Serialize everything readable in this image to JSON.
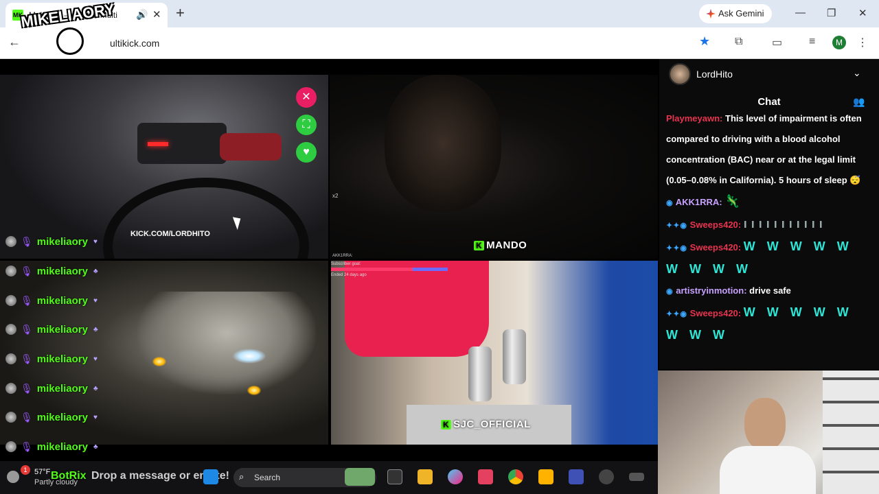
{
  "browser": {
    "tab_title": "MultiKick — Watch Multi",
    "tab_favicon": "MK",
    "new_tab_symbol": "+",
    "gemini_label": "Ask Gemini",
    "url": "ultikick.com",
    "profile_initial": "M"
  },
  "overlay_logo": {
    "text": "MIKELIAORY"
  },
  "streams": [
    {
      "label": "",
      "overlay_url": "KICK.COM/LORDHITO"
    },
    {
      "label": "MANDO",
      "multiplier": "x2"
    },
    {
      "label": ""
    },
    {
      "label": "SJC_OFFICIAL",
      "sub_goal_label": "Subscriber goal:",
      "sub_goal_ended": "Ended 24 days ago",
      "sub_goal_user": "AKK1RRA:"
    }
  ],
  "username_overlay": [
    {
      "name": "mikeliaory"
    },
    {
      "name": "mikeliaory"
    },
    {
      "name": "mikeliaory"
    },
    {
      "name": "mikeliaory"
    },
    {
      "name": "mikeliaory"
    },
    {
      "name": "mikeliaory"
    },
    {
      "name": "mikeliaory"
    },
    {
      "name": "mikeliaory"
    }
  ],
  "chat": {
    "channel_name": "LordHito",
    "title": "Chat",
    "messages": [
      {
        "user": "Playmeyawn:",
        "text": "This level of impairment is often compared to driving with a blood alcohol concentration (BAC) near or at the legal limit (0.05–0.08% in California). 5 hours of sleep 😴"
      },
      {
        "user": "AKK1RRA:",
        "text": ""
      },
      {
        "user": "Sweeps420:",
        "text": ""
      },
      {
        "user": "Sweeps420:",
        "text": "W W W W W W W W W"
      },
      {
        "user": "artistryinmotion:",
        "text": "drive safe"
      },
      {
        "user": "Sweeps420:",
        "text": "W W W W W W W W"
      }
    ]
  },
  "taskbar": {
    "notification_count": "1",
    "temperature": "57°F",
    "condition": "Partly cloudy",
    "botrix": "BotRix",
    "drop_message": "Drop a message or emote!",
    "search_placeholder": "Search"
  },
  "colors": {
    "kick_green": "#53fc18",
    "chat_red": "#e8344f",
    "emote_teal": "#2ee6d6"
  }
}
